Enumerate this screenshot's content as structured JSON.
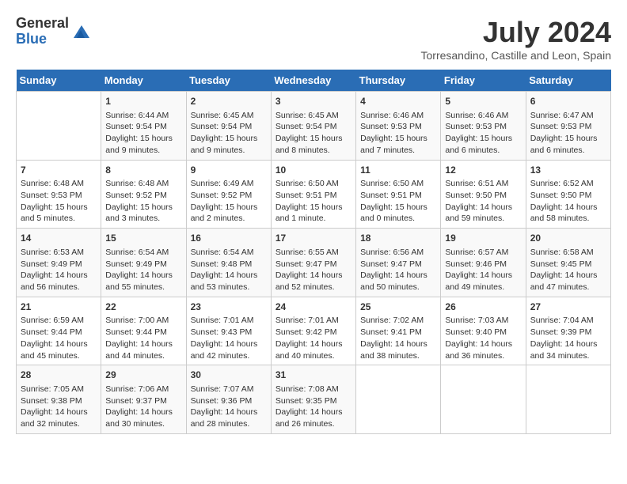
{
  "logo": {
    "general": "General",
    "blue": "Blue"
  },
  "header": {
    "month": "July 2024",
    "location": "Torresandino, Castille and Leon, Spain"
  },
  "days_of_week": [
    "Sunday",
    "Monday",
    "Tuesday",
    "Wednesday",
    "Thursday",
    "Friday",
    "Saturday"
  ],
  "weeks": [
    [
      {
        "day": "",
        "info": ""
      },
      {
        "day": "1",
        "info": "Sunrise: 6:44 AM\nSunset: 9:54 PM\nDaylight: 15 hours\nand 9 minutes."
      },
      {
        "day": "2",
        "info": "Sunrise: 6:45 AM\nSunset: 9:54 PM\nDaylight: 15 hours\nand 9 minutes."
      },
      {
        "day": "3",
        "info": "Sunrise: 6:45 AM\nSunset: 9:54 PM\nDaylight: 15 hours\nand 8 minutes."
      },
      {
        "day": "4",
        "info": "Sunrise: 6:46 AM\nSunset: 9:53 PM\nDaylight: 15 hours\nand 7 minutes."
      },
      {
        "day": "5",
        "info": "Sunrise: 6:46 AM\nSunset: 9:53 PM\nDaylight: 15 hours\nand 6 minutes."
      },
      {
        "day": "6",
        "info": "Sunrise: 6:47 AM\nSunset: 9:53 PM\nDaylight: 15 hours\nand 6 minutes."
      }
    ],
    [
      {
        "day": "7",
        "info": "Sunrise: 6:48 AM\nSunset: 9:53 PM\nDaylight: 15 hours\nand 5 minutes."
      },
      {
        "day": "8",
        "info": "Sunrise: 6:48 AM\nSunset: 9:52 PM\nDaylight: 15 hours\nand 3 minutes."
      },
      {
        "day": "9",
        "info": "Sunrise: 6:49 AM\nSunset: 9:52 PM\nDaylight: 15 hours\nand 2 minutes."
      },
      {
        "day": "10",
        "info": "Sunrise: 6:50 AM\nSunset: 9:51 PM\nDaylight: 15 hours\nand 1 minute."
      },
      {
        "day": "11",
        "info": "Sunrise: 6:50 AM\nSunset: 9:51 PM\nDaylight: 15 hours\nand 0 minutes."
      },
      {
        "day": "12",
        "info": "Sunrise: 6:51 AM\nSunset: 9:50 PM\nDaylight: 14 hours\nand 59 minutes."
      },
      {
        "day": "13",
        "info": "Sunrise: 6:52 AM\nSunset: 9:50 PM\nDaylight: 14 hours\nand 58 minutes."
      }
    ],
    [
      {
        "day": "14",
        "info": "Sunrise: 6:53 AM\nSunset: 9:49 PM\nDaylight: 14 hours\nand 56 minutes."
      },
      {
        "day": "15",
        "info": "Sunrise: 6:54 AM\nSunset: 9:49 PM\nDaylight: 14 hours\nand 55 minutes."
      },
      {
        "day": "16",
        "info": "Sunrise: 6:54 AM\nSunset: 9:48 PM\nDaylight: 14 hours\nand 53 minutes."
      },
      {
        "day": "17",
        "info": "Sunrise: 6:55 AM\nSunset: 9:47 PM\nDaylight: 14 hours\nand 52 minutes."
      },
      {
        "day": "18",
        "info": "Sunrise: 6:56 AM\nSunset: 9:47 PM\nDaylight: 14 hours\nand 50 minutes."
      },
      {
        "day": "19",
        "info": "Sunrise: 6:57 AM\nSunset: 9:46 PM\nDaylight: 14 hours\nand 49 minutes."
      },
      {
        "day": "20",
        "info": "Sunrise: 6:58 AM\nSunset: 9:45 PM\nDaylight: 14 hours\nand 47 minutes."
      }
    ],
    [
      {
        "day": "21",
        "info": "Sunrise: 6:59 AM\nSunset: 9:44 PM\nDaylight: 14 hours\nand 45 minutes."
      },
      {
        "day": "22",
        "info": "Sunrise: 7:00 AM\nSunset: 9:44 PM\nDaylight: 14 hours\nand 44 minutes."
      },
      {
        "day": "23",
        "info": "Sunrise: 7:01 AM\nSunset: 9:43 PM\nDaylight: 14 hours\nand 42 minutes."
      },
      {
        "day": "24",
        "info": "Sunrise: 7:01 AM\nSunset: 9:42 PM\nDaylight: 14 hours\nand 40 minutes."
      },
      {
        "day": "25",
        "info": "Sunrise: 7:02 AM\nSunset: 9:41 PM\nDaylight: 14 hours\nand 38 minutes."
      },
      {
        "day": "26",
        "info": "Sunrise: 7:03 AM\nSunset: 9:40 PM\nDaylight: 14 hours\nand 36 minutes."
      },
      {
        "day": "27",
        "info": "Sunrise: 7:04 AM\nSunset: 9:39 PM\nDaylight: 14 hours\nand 34 minutes."
      }
    ],
    [
      {
        "day": "28",
        "info": "Sunrise: 7:05 AM\nSunset: 9:38 PM\nDaylight: 14 hours\nand 32 minutes."
      },
      {
        "day": "29",
        "info": "Sunrise: 7:06 AM\nSunset: 9:37 PM\nDaylight: 14 hours\nand 30 minutes."
      },
      {
        "day": "30",
        "info": "Sunrise: 7:07 AM\nSunset: 9:36 PM\nDaylight: 14 hours\nand 28 minutes."
      },
      {
        "day": "31",
        "info": "Sunrise: 7:08 AM\nSunset: 9:35 PM\nDaylight: 14 hours\nand 26 minutes."
      },
      {
        "day": "",
        "info": ""
      },
      {
        "day": "",
        "info": ""
      },
      {
        "day": "",
        "info": ""
      }
    ]
  ]
}
